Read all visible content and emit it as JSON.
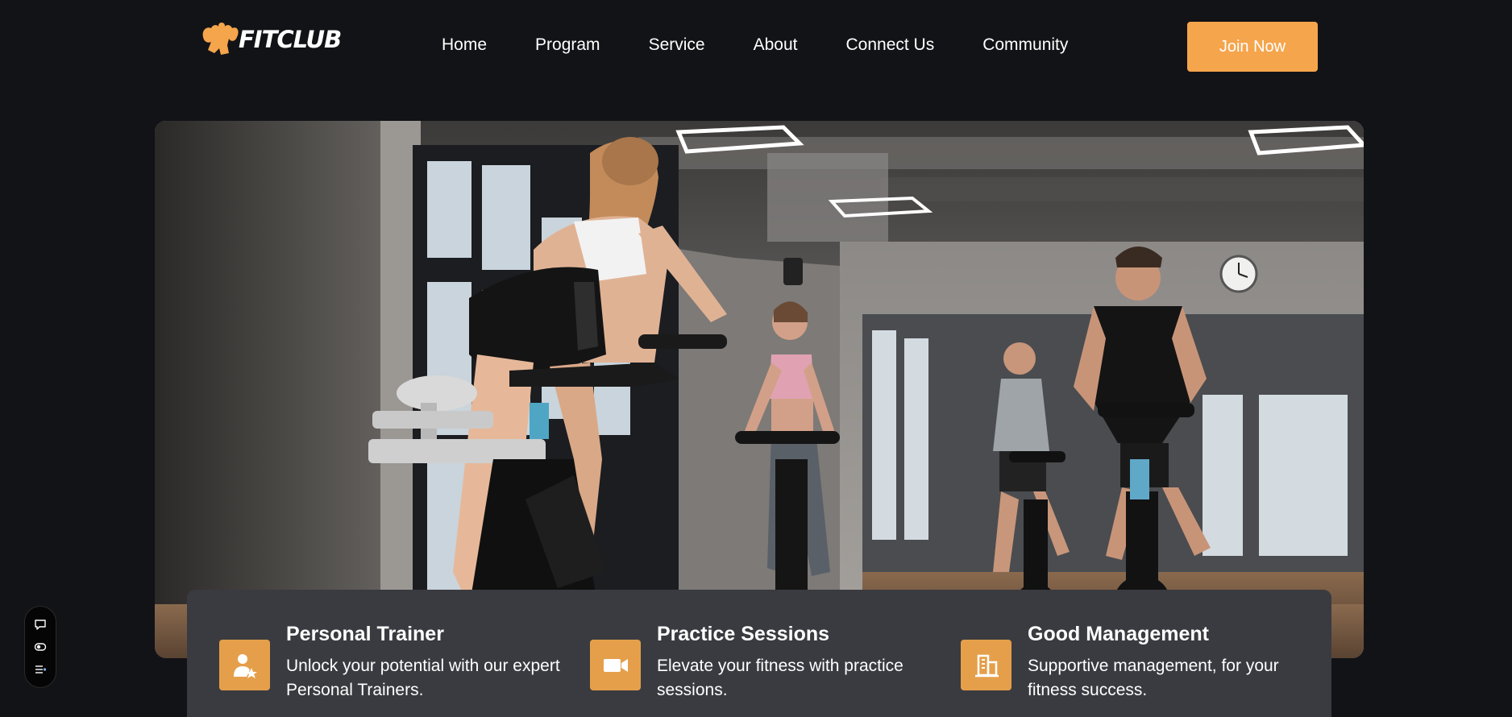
{
  "header": {
    "logo_text": "FITCLUB",
    "nav": [
      "Home",
      "Program",
      "Service",
      "About",
      "Connect Us",
      "Community"
    ],
    "cta_label": "Join Now"
  },
  "features": [
    {
      "icon": "personal-trainer-icon",
      "title": "Personal Trainer",
      "description": "Unlock your potential with our expert Personal Trainers."
    },
    {
      "icon": "video-camera-icon",
      "title": "Practice Sessions",
      "description": "Elevate your fitness with practice sessions."
    },
    {
      "icon": "building-icon",
      "title": "Good Management",
      "description": "Supportive management, for your fitness success."
    }
  ],
  "side_toolbar": [
    "chat-icon",
    "toggle-icon",
    "settings-list-icon"
  ],
  "colors": {
    "background": "#121317",
    "accent": "#f5a54c",
    "card": "#3a3b40",
    "text": "#ffffff"
  }
}
